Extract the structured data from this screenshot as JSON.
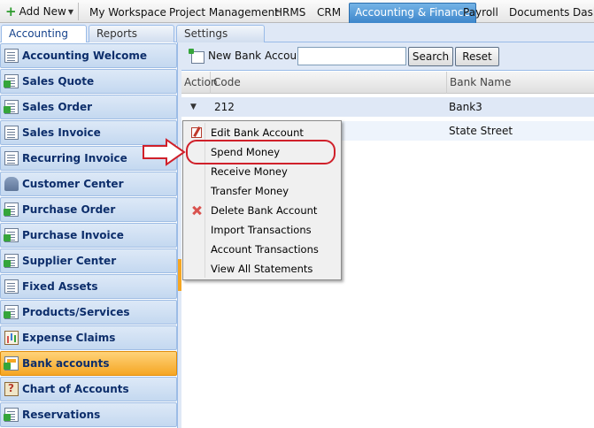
{
  "topnav": {
    "add_new": "Add New",
    "items": [
      "My Workspace",
      "Project Management",
      "HRMS",
      "CRM",
      "Accounting & Finance",
      "Payroll",
      "Documents",
      "Dash"
    ],
    "active": "Accounting & Finance"
  },
  "subtabs": [
    "Accounting",
    "Reports",
    "Settings"
  ],
  "sidebar": {
    "items": [
      {
        "label": "Accounting Welcome",
        "icon": "document-icon"
      },
      {
        "label": "Sales Quote",
        "icon": "quote-icon"
      },
      {
        "label": "Sales Order",
        "icon": "order-icon"
      },
      {
        "label": "Sales Invoice",
        "icon": "invoice-icon"
      },
      {
        "label": "Recurring Invoice",
        "icon": "recurring-invoice-icon"
      },
      {
        "label": "Customer Center",
        "icon": "customer-icon"
      },
      {
        "label": "Purchase Order",
        "icon": "purchase-order-icon"
      },
      {
        "label": "Purchase Invoice",
        "icon": "purchase-invoice-icon"
      },
      {
        "label": "Supplier Center",
        "icon": "supplier-icon"
      },
      {
        "label": "Fixed Assets",
        "icon": "fixed-assets-icon"
      },
      {
        "label": "Products/Services",
        "icon": "products-icon"
      },
      {
        "label": "Expense Claims",
        "icon": "expense-chart-icon"
      },
      {
        "label": "Bank accounts",
        "icon": "bank-icon"
      },
      {
        "label": "Chart of Accounts",
        "icon": "chart-of-accounts-icon"
      },
      {
        "label": "Reservations",
        "icon": "reservations-icon"
      }
    ],
    "active": "Bank accounts"
  },
  "toolbar": {
    "new_label": "New Bank Account",
    "search_value": "",
    "search_button": "Search",
    "reset_button": "Reset"
  },
  "grid": {
    "columns": [
      "Action",
      "Code",
      "Bank Name"
    ],
    "rows": [
      {
        "code": "212",
        "bank_name": "Bank3"
      },
      {
        "code": "",
        "bank_name": "State Street"
      }
    ]
  },
  "context_menu": {
    "items": [
      "Edit Bank Account",
      "Spend Money",
      "Receive Money",
      "Transfer Money",
      "Delete Bank Account",
      "Import Transactions",
      "Account Transactions",
      "View All Statements"
    ],
    "highlighted": "Spend Money"
  },
  "colors": {
    "highlight_ring": "#d0202a",
    "active_tab": "#3d86cb",
    "active_sidebar": "#f5a623"
  }
}
